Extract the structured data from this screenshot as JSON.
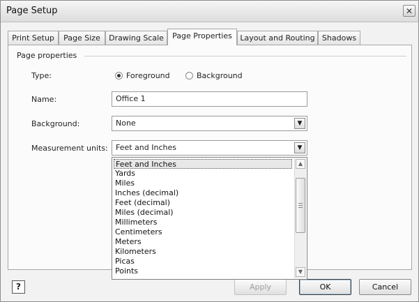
{
  "window": {
    "title": "Page Setup"
  },
  "tabs": [
    {
      "label": "Print Setup"
    },
    {
      "label": "Page Size"
    },
    {
      "label": "Drawing Scale"
    },
    {
      "label": "Page Properties",
      "active": true
    },
    {
      "label": "Layout and Routing"
    },
    {
      "label": "Shadows"
    }
  ],
  "group": {
    "label": "Page properties"
  },
  "type": {
    "label": "Type:",
    "options": [
      {
        "label": "Foreground",
        "checked": true
      },
      {
        "label": "Background",
        "checked": false
      }
    ]
  },
  "name": {
    "label": "Name:",
    "value": "Office 1"
  },
  "background": {
    "label": "Background:",
    "value": "None"
  },
  "units": {
    "label": "Measurement units:",
    "value": "Feet and Inches",
    "options": [
      "Feet and Inches",
      "Yards",
      "Miles",
      "Inches (decimal)",
      "Feet (decimal)",
      "Miles (decimal)",
      "Millimeters",
      "Centimeters",
      "Meters",
      "Kilometers",
      "Picas",
      "Points"
    ],
    "selected_index": 0
  },
  "buttons": {
    "help": "?",
    "apply": "Apply",
    "ok": "OK",
    "cancel": "Cancel"
  },
  "icons": {
    "close": "close-icon",
    "dropdown": "chevron-down-icon",
    "help": "help-icon"
  }
}
